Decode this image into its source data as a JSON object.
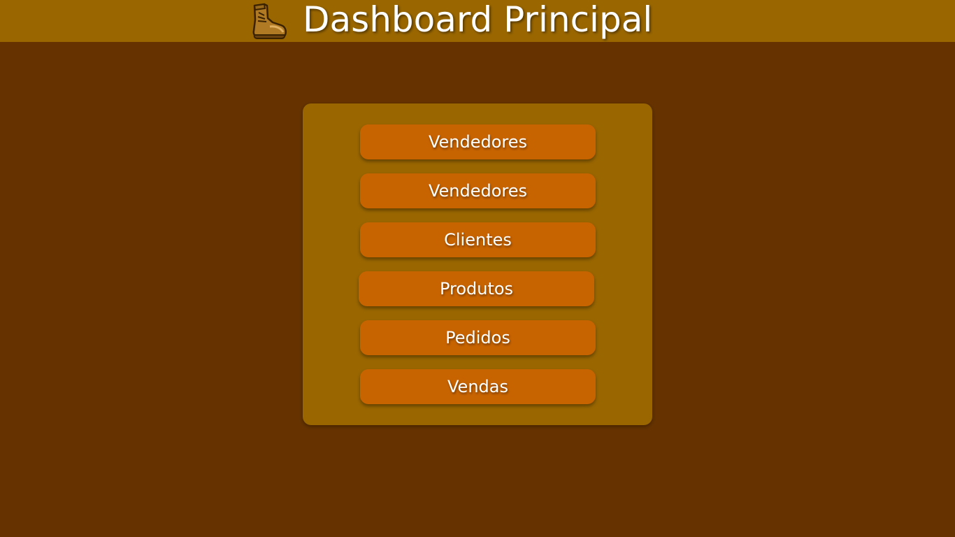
{
  "header": {
    "title": "Dashboard Principal",
    "logo_icon": "boot-icon",
    "background_color": "#996600"
  },
  "page": {
    "background_color": "#663300"
  },
  "menu": {
    "background_color": "#996600",
    "button_color": "#c86400",
    "items": [
      {
        "label": "Vendedores"
      },
      {
        "label": "Vendedores"
      },
      {
        "label": "Clientes"
      },
      {
        "label": "Produtos"
      },
      {
        "label": "Pedidos"
      },
      {
        "label": "Vendas"
      }
    ]
  }
}
